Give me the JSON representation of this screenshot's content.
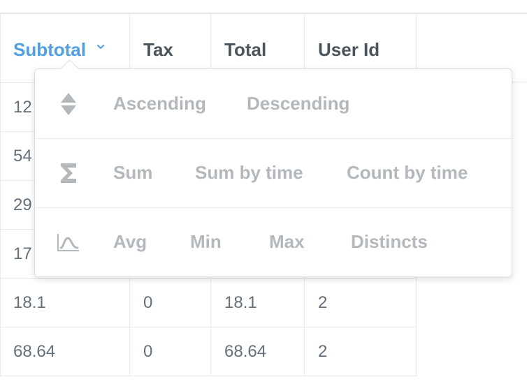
{
  "table": {
    "columns": [
      {
        "label": "Subtotal",
        "active": true
      },
      {
        "label": "Tax",
        "active": false
      },
      {
        "label": "Total",
        "active": false
      },
      {
        "label": "User Id",
        "active": false
      }
    ],
    "rows": [
      {
        "subtotal": "12",
        "tax": "",
        "total": "",
        "user_id": ""
      },
      {
        "subtotal": "54",
        "tax": "",
        "total": "",
        "user_id": ""
      },
      {
        "subtotal": "29",
        "tax": "",
        "total": "",
        "user_id": ""
      },
      {
        "subtotal": "17",
        "tax": "",
        "total": "",
        "user_id": ""
      },
      {
        "subtotal": "18.1",
        "tax": "0",
        "total": "18.1",
        "user_id": "2"
      },
      {
        "subtotal": "68.64",
        "tax": "0",
        "total": "68.64",
        "user_id": "2"
      }
    ]
  },
  "popover": {
    "sort": {
      "icon": "sort-arrows-icon",
      "ascending": "Ascending",
      "descending": "Descending"
    },
    "sum": {
      "icon": "sigma-icon",
      "sum": "Sum",
      "sum_by_time": "Sum by time",
      "count_by_time": "Count by time"
    },
    "stats": {
      "icon": "distribution-icon",
      "avg": "Avg",
      "min": "Min",
      "max": "Max",
      "distincts": "Distincts"
    }
  },
  "colors": {
    "accent": "#509ee3",
    "header_text": "#4a545c",
    "cell_text": "#63707b",
    "option_text": "#b3b8bd",
    "icon": "#b3b8bd"
  }
}
